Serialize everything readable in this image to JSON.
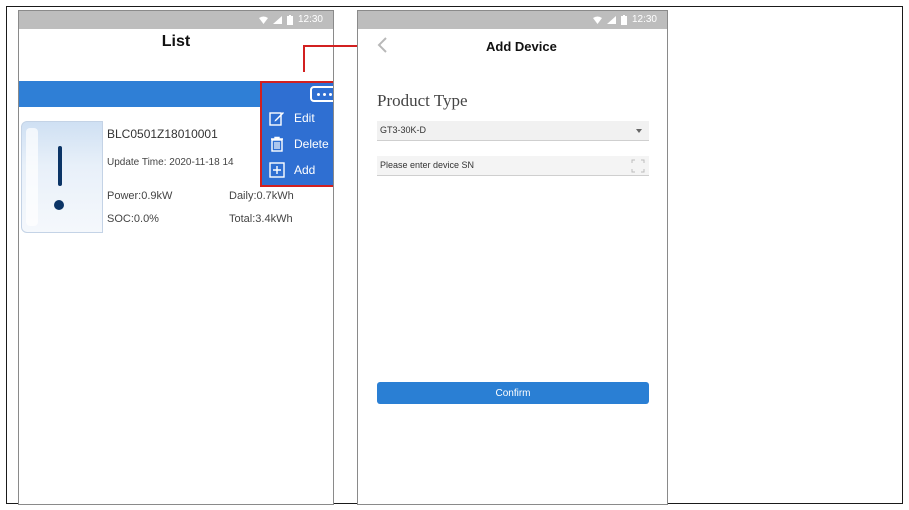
{
  "status_bar": {
    "time": "12:30"
  },
  "list_screen": {
    "title": "List",
    "device": {
      "sn": "BLC0501Z18010001",
      "update_time": "Update Time: 2020-11-18 14",
      "power": "Power:0.9kW",
      "daily": "Daily:0.7kWh",
      "soc": "SOC:0.0%",
      "total": "Total:3.4kWh"
    },
    "menu": {
      "items": [
        {
          "label": "Edit",
          "icon": "edit-icon"
        },
        {
          "label": "Delete",
          "icon": "trash-icon"
        },
        {
          "label": "Add",
          "icon": "plus-icon"
        }
      ]
    }
  },
  "add_device_screen": {
    "title": "Add Device",
    "product_type_label": "Product Type",
    "product_type_selected": "GT3-30K-D",
    "sn_placeholder": "Please enter device SN",
    "confirm_label": "Confirm"
  },
  "colors": {
    "accent_blue": "#2f7fd6",
    "menu_blue": "#2f6fd2",
    "highlight_red": "#d22020"
  }
}
